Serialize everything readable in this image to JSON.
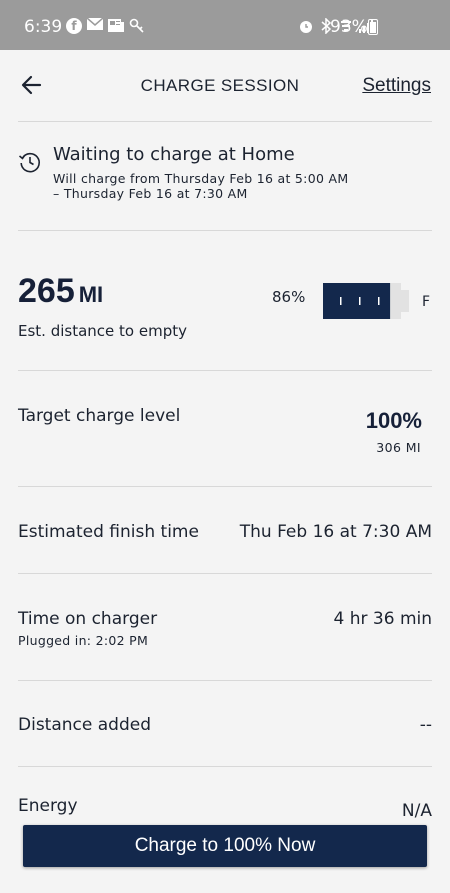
{
  "status_bar": {
    "time": "6:39",
    "battery": "93%",
    "icons_left": [
      "facebook-icon",
      "mail-icon",
      "news-icon",
      "key-icon"
    ],
    "icons_right": [
      "alarm-icon",
      "bluetooth-icon",
      "wifi-icon",
      "signal-icon",
      "battery-charging-icon"
    ]
  },
  "header": {
    "title": "CHARGE SESSION",
    "settings_label": "Settings"
  },
  "waiting": {
    "title": "Waiting to charge at Home",
    "line1": "Will charge from Thursday Feb 16 at 5:00 AM",
    "line2": "– Thursday Feb 16 at 7:30 AM"
  },
  "range": {
    "value": "265",
    "unit": "MI",
    "label": "Est. distance to empty",
    "battery_pct": "86%",
    "battery_level": 0.86,
    "full_label": "F"
  },
  "target": {
    "label": "Target charge level",
    "pct": "100%",
    "miles": "306 MI"
  },
  "finish": {
    "label": "Estimated finish time",
    "value": "Thu Feb 16 at 7:30 AM"
  },
  "time_on_charger": {
    "label": "Time on charger",
    "value": "4 hr 36 min",
    "plugged_in": "Plugged in: 2:02 PM"
  },
  "distance_added": {
    "label": "Distance added",
    "value": "--"
  },
  "energy": {
    "label": "Energy",
    "value": "N/A"
  },
  "button": {
    "label": "Charge to 100% Now"
  },
  "colors": {
    "primary": "#13284c",
    "status_bar": "#9b9b9b",
    "background": "#f4f4f4"
  }
}
